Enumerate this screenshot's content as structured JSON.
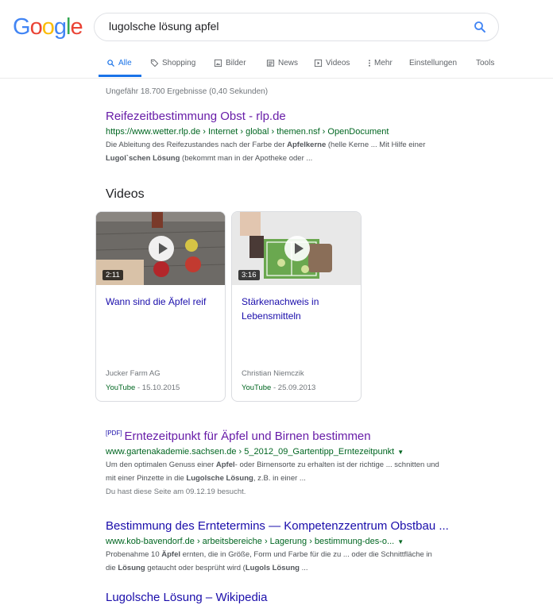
{
  "logo": {
    "letters": [
      "G",
      "o",
      "o",
      "g",
      "l",
      "e"
    ],
    "colors": [
      "#4285f4",
      "#ea4335",
      "#fbbc05",
      "#4285f4",
      "#34a853",
      "#ea4335"
    ]
  },
  "search": {
    "query": "lugolsche lösung apfel",
    "icon": "search-icon"
  },
  "tabs": [
    {
      "label": "Alle",
      "icon": "search-icon",
      "active": true
    },
    {
      "label": "Shopping",
      "icon": "tag-icon"
    },
    {
      "label": "Bilder",
      "icon": "image-icon"
    },
    {
      "label": "News",
      "icon": "news-icon"
    },
    {
      "label": "Videos",
      "icon": "play-icon"
    },
    {
      "label": "Mehr",
      "icon": "more-vert-icon"
    },
    {
      "label": "Einstellungen"
    },
    {
      "label": "Tools"
    }
  ],
  "stats": "Ungefähr 18.700 Ergebnisse (0,40 Sekunden)",
  "results": [
    {
      "title": "Reifezeitbestimmung Obst - rlp.de",
      "url": "https://www.wetter.rlp.de › Internet › global › themen.nsf › OpenDocument",
      "snippet_1a": "Die Ableitung des Reifezustandes nach der Farbe der ",
      "snippet_1b": "Apfelkerne",
      "snippet_1c": " (helle Kerne ... Mit Hilfe einer",
      "snippet_2a": "Lugol`schen Lösung",
      "snippet_2b": " (bekommt man in der Apotheke oder ..."
    },
    {
      "pdf": "[PDF]",
      "title": "Erntezeitpunkt für Äpfel und Birnen bestimmen",
      "url": "www.gartenakademie.sachsen.de › 5_2012_09_Gartentipp_Erntezeitpunkt",
      "snippet_1a": "Um den optimalen Genuss einer ",
      "snippet_1b": "Apfel",
      "snippet_1c": "- oder Birnensorte zu erhalten ist der richtige ... schnitten und",
      "snippet_2a": "mit einer Pinzette in die ",
      "snippet_2b": "Lugolsche Lösung",
      "snippet_2c": ", z.B. in einer ...",
      "visited": "Du hast diese Seite am 09.12.19 besucht."
    },
    {
      "title": "Bestimmung des Erntetermins — Kompetenzzentrum Obstbau ...",
      "url": "www.kob-bavendorf.de › arbeitsbereiche › Lagerung › bestimmung-des-o...",
      "snippet_1a": "Probenahme 10 ",
      "snippet_1b": "Äpfel",
      "snippet_1c": " ernten, die in Größe, Form und Farbe für die zu ... oder die Schnittfläche in",
      "snippet_2a": "die ",
      "snippet_2b": "Lösung",
      "snippet_2c": " getaucht oder besprüht wird (",
      "snippet_2d": "Lugols Lösung",
      "snippet_2e": " ..."
    }
  ],
  "videos": {
    "heading": "Videos",
    "items": [
      {
        "duration": "2:11",
        "title": "Wann sind die Äpfel reif",
        "source": "Jucker Farm AG",
        "platform": "YouTube",
        "date": " - 15.10.2015"
      },
      {
        "duration": "3:16",
        "title": "Stärkenachweis in Lebensmitteln",
        "source": "Christian Niemczik",
        "platform": "YouTube",
        "date": " - 25.09.2013"
      }
    ]
  },
  "cutoff_title": "Lugolsche Lösung – Wikipedia"
}
